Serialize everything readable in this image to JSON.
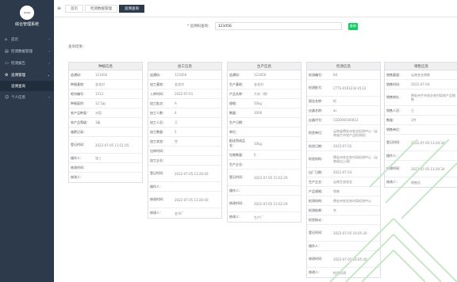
{
  "sidebar": {
    "app_title": "综合管理系统",
    "logo_text": "LOGO",
    "items": [
      {
        "label": "首页",
        "icon": "home-icon"
      },
      {
        "label": "检测数据管理",
        "icon": "data-icon"
      },
      {
        "label": "检测报告",
        "icon": "report-icon"
      },
      {
        "label": "追溯管理",
        "icon": "trace-icon"
      },
      {
        "label": "追溯查询",
        "icon": "sub-item"
      },
      {
        "label": "个人信息",
        "icon": "user-icon"
      }
    ]
  },
  "topbar": {
    "tabs": [
      {
        "label": "首页"
      },
      {
        "label": "检测数据管理"
      },
      {
        "label": "追溯查询"
      }
    ]
  },
  "search": {
    "label": "* 追溯码查询：",
    "value": "123456",
    "button": "查询"
  },
  "result_label": "查询结果：",
  "cards": [
    {
      "title": "种植信息",
      "rows": [
        {
          "k": "追溯码：",
          "v": "123456"
        },
        {
          "k": "种植基地：",
          "v": "金花村"
        },
        {
          "k": "地块编号：",
          "v": "1513"
        },
        {
          "k": "种植面积：",
          "v": "12.5亩"
        },
        {
          "k": "农产品种类：",
          "v": "水稻"
        },
        {
          "k": "农产品等级：",
          "v": "1级"
        },
        {
          "k": "施肥记录：",
          "v": ""
        },
        {
          "k": "登记时间：",
          "v": "2022-07-05 11:51:05"
        },
        {
          "k": "操作人：",
          "v": "张三"
        },
        {
          "k": "修改时间：",
          "v": ""
        },
        {
          "k": "修改人：",
          "v": ""
        }
      ]
    },
    {
      "title": "加工信息",
      "rows": [
        {
          "k": "追溯码：",
          "v": "123456"
        },
        {
          "k": "加工基地：",
          "v": "金花村"
        },
        {
          "k": "入库时间：",
          "v": "2022-07-01"
        },
        {
          "k": "加工批次：",
          "v": "A"
        },
        {
          "k": "加工人数：",
          "v": "4"
        },
        {
          "k": "加工人员：",
          "v": "王"
        },
        {
          "k": "加工数量：",
          "v": "5"
        },
        {
          "k": "加工状态：",
          "v": "完"
        },
        {
          "k": "出库时间：",
          "v": ""
        },
        {
          "k": "加工企业：",
          "v": ""
        },
        {
          "k": "登记时间：",
          "v": "2022-07-05 13:20:40"
        },
        {
          "k": "操作人：",
          "v": ""
        },
        {
          "k": "修改时间：",
          "v": "2022-07-05 13:20:40"
        },
        {
          "k": "修改人：",
          "v": "金华厂"
        }
      ]
    },
    {
      "title": "生产信息",
      "rows": [
        {
          "k": "追溯码：",
          "v": "123456"
        },
        {
          "k": "生产基地：",
          "v": "金花村"
        },
        {
          "k": "产品名称：",
          "v": "大米（袋）"
        },
        {
          "k": "规格：",
          "v": "50kg"
        },
        {
          "k": "数量：",
          "v": "1000"
        },
        {
          "k": "生产日期：",
          "v": ""
        },
        {
          "k": "单位：",
          "v": ""
        },
        {
          "k": "配送到成品仓：",
          "v": "10kg"
        },
        {
          "k": "包装数量：",
          "v": "6"
        },
        {
          "k": "生产企业：",
          "v": ""
        },
        {
          "k": "登记时间：",
          "v": "2022-07-05 15:02:29"
        },
        {
          "k": "操作人：",
          "v": ""
        },
        {
          "k": "修改时间：",
          "v": "2022-07-05 15:02:29"
        },
        {
          "k": "修改人：",
          "v": "生产厂"
        }
      ]
    },
    {
      "title": "检测信息",
      "rows": [
        {
          "k": "检测编号：",
          "v": "B4"
        },
        {
          "k": "检测批号：",
          "v": "CTTS-0191232-0133"
        },
        {
          "k": "报告名称：",
          "v": "检"
        },
        {
          "k": "仪器名称：",
          "v": "ac"
        },
        {
          "k": "仪器代号：",
          "v": "CD3000100012"
        },
        {
          "k": "检验单位：",
          "v": "云南省德宏州农业检测中心（云南省芒市农产品检测站）"
        },
        {
          "k": "检验日期：",
          "v": "2022-07-02"
        },
        {
          "k": "检验机构：",
          "v": "德宏州农业农村局检测中心（云南省出入境）"
        },
        {
          "k": "出厂日期：",
          "v": "2022-07-03"
        },
        {
          "k": "生产企业：",
          "v": "云南生态农业"
        },
        {
          "k": "产品规格：",
          "v": "袋装"
        },
        {
          "k": "检测机构：",
          "v": "德宏州农业农村局检测中心"
        },
        {
          "k": "检测结果：",
          "v": "合"
        },
        {
          "k": "检验结论：",
          "v": ""
        },
        {
          "k": "登记时间：",
          "v": "2022-07-05 16:05:30"
        },
        {
          "k": "操作人：",
          "v": ""
        },
        {
          "k": "修改时间：",
          "v": "2022-07-05 16:05:30"
        },
        {
          "k": "修改人：",
          "v": "检验检测"
        }
      ]
    },
    {
      "title": "销售信息",
      "rows": [
        {
          "k": "销售渠道：",
          "v": "云南农业销售"
        },
        {
          "k": "销售时间：",
          "v": "2022-07-04"
        },
        {
          "k": "销售地址：",
          "v": "德宏州芒市农业农村局农产品销售"
        },
        {
          "k": "销售人员：",
          "v": "王"
        },
        {
          "k": "数量：",
          "v": "1件"
        },
        {
          "k": "销售单位：",
          "v": ""
        },
        {
          "k": "登记时间：",
          "v": "2022-07-05 13:20:34"
        },
        {
          "k": "操作人：",
          "v": ""
        },
        {
          "k": "修改时间：",
          "v": "2022-07-05 13:20:34"
        },
        {
          "k": "修改人：",
          "v": "销售员"
        }
      ]
    }
  ]
}
